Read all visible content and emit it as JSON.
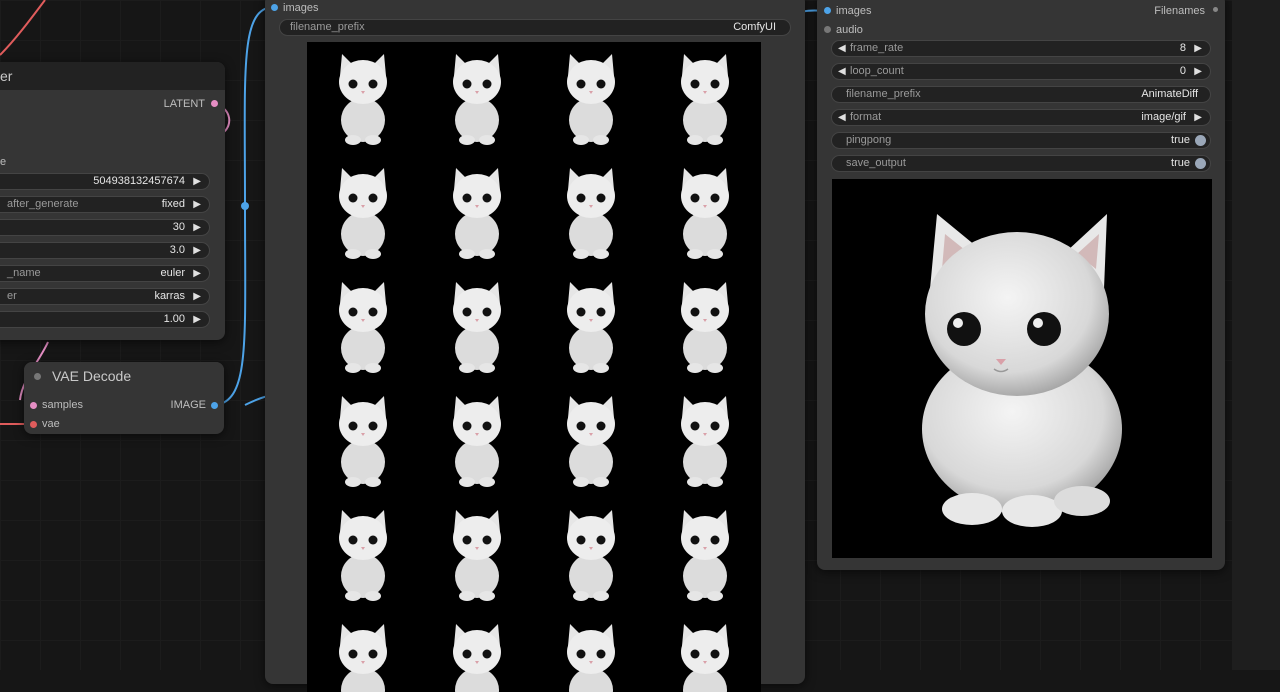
{
  "colors": {
    "image_link": "#4da3e8",
    "latent_link": "#e58ec4",
    "vae_link": "#e05c5c",
    "canvas": "#161616",
    "node_bg": "#353535",
    "node_title_bg": "#222222"
  },
  "sampler_node": {
    "title_fragment": "er",
    "output_latent": "LATENT",
    "section_label_fragment": "e",
    "widgets": [
      {
        "label": "",
        "value": "504938132457674"
      },
      {
        "label": "after_generate",
        "value": "fixed"
      },
      {
        "label": "",
        "value": "30"
      },
      {
        "label": "",
        "value": "3.0"
      },
      {
        "label": "_name",
        "value": "euler"
      },
      {
        "label": "er",
        "value": "karras"
      },
      {
        "label": "",
        "value": "1.00"
      }
    ]
  },
  "vae_decode_node": {
    "title": "VAE Decode",
    "input_samples": "samples",
    "input_vae": "vae",
    "output_image": "IMAGE"
  },
  "preview_node": {
    "input_images": "images",
    "filename_prefix_label": "filename_prefix",
    "filename_prefix_value": "ComfyUI",
    "grid_rows": 6,
    "grid_cols": 4
  },
  "combine_node": {
    "input_images": "images",
    "input_audio": "audio",
    "output_filenames": "Filenames",
    "widgets": [
      {
        "label": "frame_rate",
        "value": "8",
        "type": "number"
      },
      {
        "label": "loop_count",
        "value": "0",
        "type": "number"
      },
      {
        "label": "filename_prefix",
        "value": "AnimateDiff",
        "type": "text"
      },
      {
        "label": "format",
        "value": "image/gif",
        "type": "combo"
      },
      {
        "label": "pingpong",
        "value": "true",
        "type": "toggle"
      },
      {
        "label": "save_output",
        "value": "true",
        "type": "toggle"
      }
    ]
  },
  "icons": {
    "arrow_right": "▶",
    "arrow_left": "◀"
  }
}
